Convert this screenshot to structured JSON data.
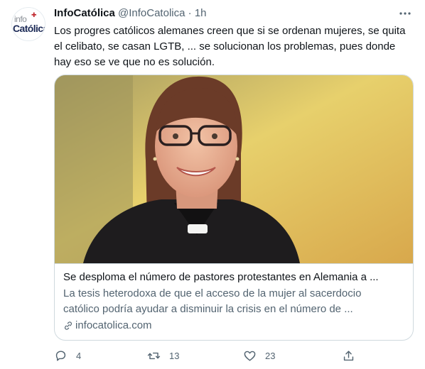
{
  "account": {
    "name": "InfoCatólica",
    "handle": "@InfoCatolica",
    "separator": "·",
    "time": "1h",
    "avatar_logo_top": "info",
    "avatar_logo_bottom": "Católica"
  },
  "tweet_text": "Los progres católicos alemanes creen que si se ordenan mujeres, se quita el celibato, se casan LGTB, ... se solucionan los problemas, pues donde hay eso se ve que no es solución.",
  "card": {
    "title": "Se desploma el número de pastores protestantes en Alemania a ...",
    "description": "La tesis heterodoxa de que el acceso de la mujer al sacerdocio católico podría ayudar a disminuir la crisis en el número de ...",
    "domain": "infocatolica.com"
  },
  "actions": {
    "replies": "4",
    "retweets": "13",
    "likes": "23"
  },
  "icons": [
    "more-icon",
    "link-icon",
    "reply-icon",
    "retweet-icon",
    "like-icon",
    "share-icon"
  ],
  "colors": {
    "text": "#0f1419",
    "secondary": "#536471",
    "border": "#cfd9de"
  }
}
